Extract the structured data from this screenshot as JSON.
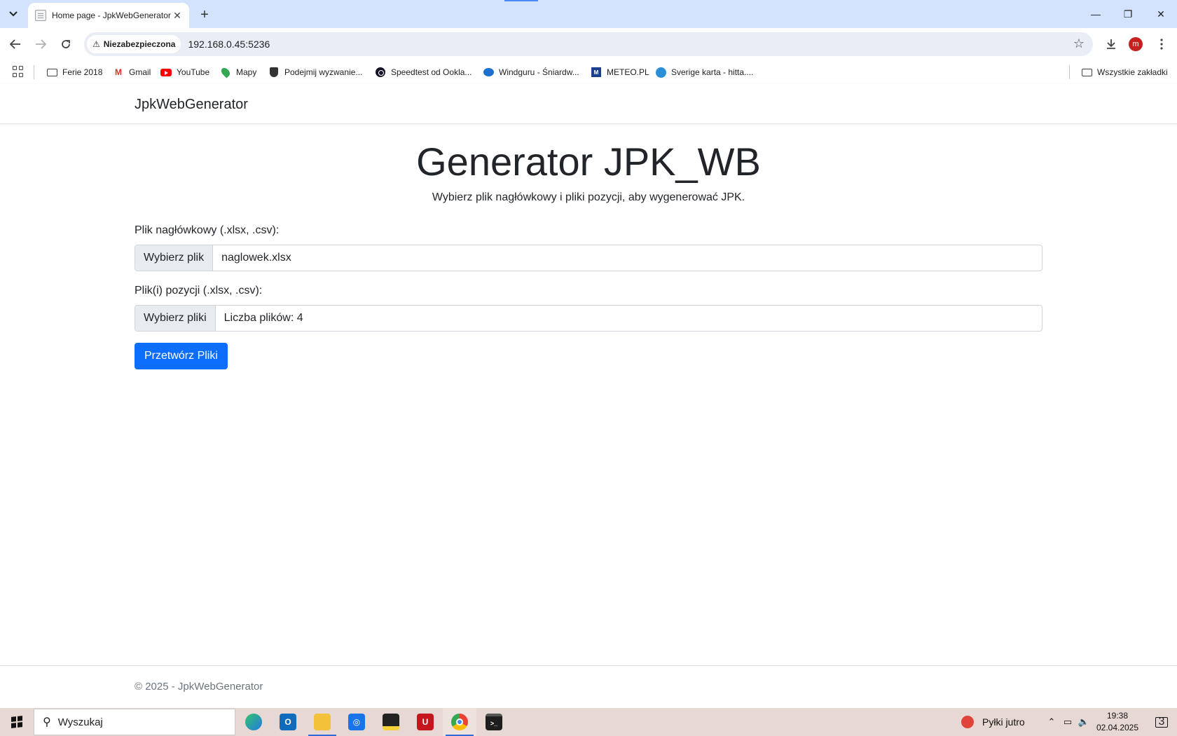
{
  "browser": {
    "tab": {
      "title": "Home page - JpkWebGenerator"
    },
    "address_bar": {
      "security_label": "Niezabezpieczona",
      "url": "192.168.0.45:5236"
    },
    "avatar_initial": "m",
    "bookmarks": [
      {
        "label": "Ferie 2018",
        "icon": "folder-icon"
      },
      {
        "label": "Gmail",
        "icon": "gmail-icon"
      },
      {
        "label": "YouTube",
        "icon": "youtube-icon"
      },
      {
        "label": "Mapy",
        "icon": "maps-icon"
      },
      {
        "label": "Podejmij wyzwanie...",
        "icon": "shield-icon"
      },
      {
        "label": "Speedtest od Ookla...",
        "icon": "speedtest-icon"
      },
      {
        "label": "Windguru - Śniardw...",
        "icon": "windguru-icon"
      },
      {
        "label": "METEO.PL",
        "icon": "meteo-icon"
      },
      {
        "label": "Sverige karta - hitta....",
        "icon": "hitta-icon"
      }
    ],
    "all_bookmarks_label": "Wszystkie zakładki"
  },
  "app": {
    "brand": "JpkWebGenerator",
    "title": "Generator JPK_WB",
    "subtitle": "Wybierz plik nagłówkowy i pliki pozycji, aby wygenerować JPK.",
    "header_file": {
      "label": "Plik nagłówkowy (.xlsx, .csv):",
      "button": "Wybierz plik",
      "value": "naglowek.xlsx"
    },
    "position_files": {
      "label": "Plik(i) pozycji (.xlsx, .csv):",
      "button": "Wybierz pliki",
      "value": "Liczba plików: 4"
    },
    "submit_label": "Przetwórz Pliki",
    "footer": "© 2025 - JpkWebGenerator"
  },
  "taskbar": {
    "search_placeholder": "Wyszukaj",
    "apps": [
      "edge-icon",
      "outlook-icon",
      "file-explorer-icon",
      "app-icon",
      "sticky-notes-icon",
      "app-red-icon",
      "chrome-icon",
      "terminal-icon"
    ],
    "weather": "Pyłki jutro",
    "time": "19:38",
    "date": "02.04.2025",
    "notification_count": "3"
  },
  "colors": {
    "primary": "#0d6efd",
    "tabstrip": "#d3e3fd",
    "taskbar": "#e7d8d3"
  }
}
